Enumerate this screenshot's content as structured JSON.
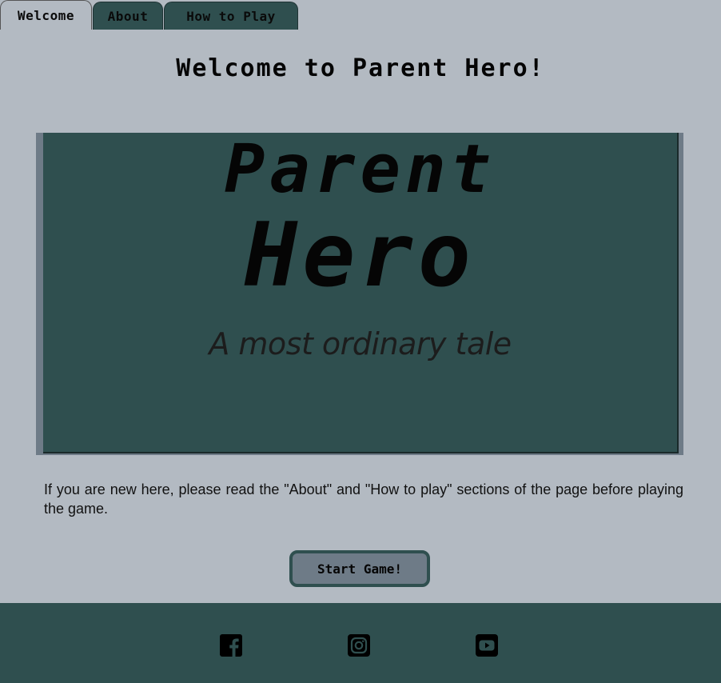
{
  "tabs": [
    {
      "label": "Welcome",
      "active": true
    },
    {
      "label": "About",
      "active": false
    },
    {
      "label": "How to Play",
      "active": false
    }
  ],
  "page_title": "Welcome to Parent Hero!",
  "hero": {
    "line1": "Parent",
    "line2": "Hero",
    "tagline": "A most ordinary tale"
  },
  "intro_text": "If you are new here, please read the \"About\" and \"How to play\" sections of the page before playing the game.",
  "start_button_label": "Start Game!",
  "footer": {
    "social_icons": [
      "facebook-icon",
      "instagram-icon",
      "youtube-icon"
    ]
  },
  "colors": {
    "background": "#b3bac2",
    "dark_slate": "#2f4f4f",
    "slate_gray": "#6e7b87"
  }
}
